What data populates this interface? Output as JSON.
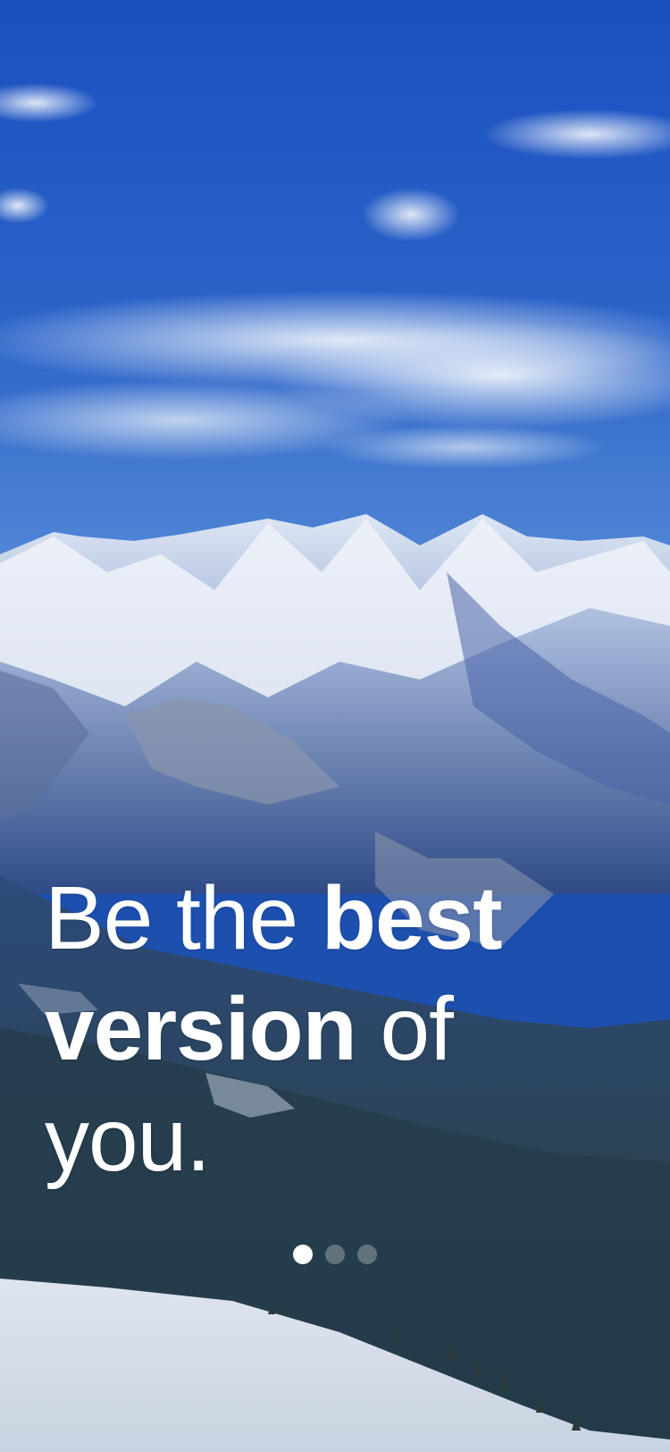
{
  "onboarding": {
    "headline": {
      "line1_regular": "Be the ",
      "line1_bold": "best",
      "line2_bold": "version",
      "line2_regular": " of",
      "line3_regular": "you."
    },
    "pager": {
      "total_pages": 3,
      "active_page": 1
    }
  },
  "background": {
    "image": "snow-capped-mountain-range",
    "sky_color": "#1d55c4",
    "snow_color": "#e6ecf5",
    "forest_color": "#24384a"
  }
}
